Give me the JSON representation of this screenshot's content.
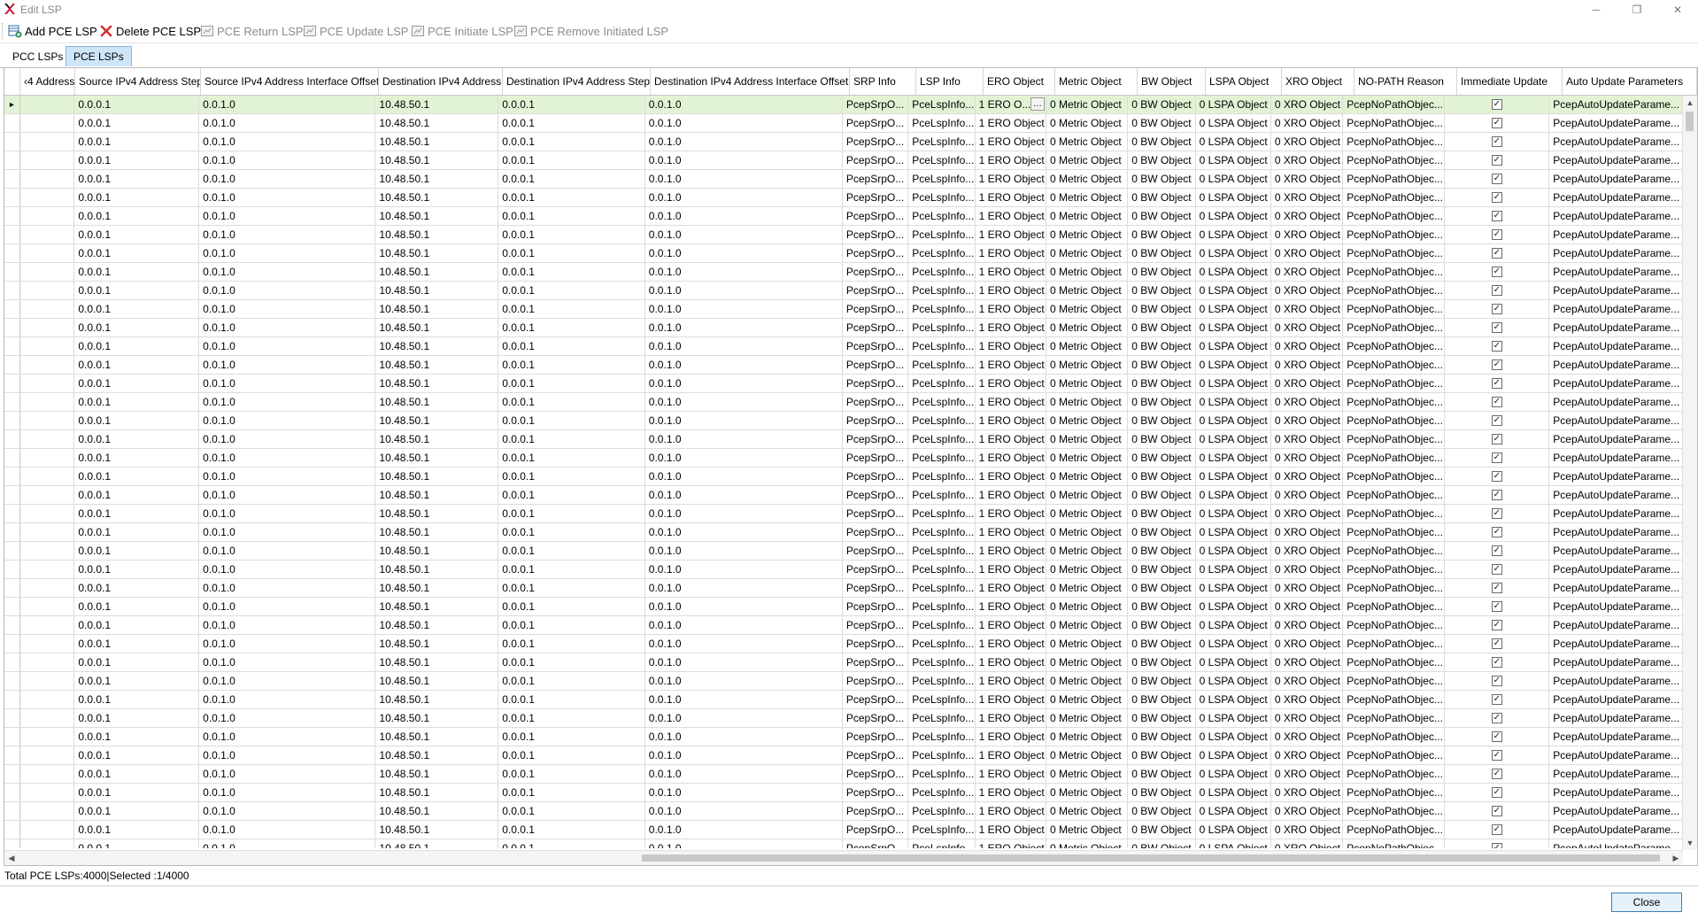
{
  "window": {
    "title": "Edit LSP",
    "controls": {
      "minimize": "─",
      "restore": "❐",
      "close": "✕"
    }
  },
  "toolbar": {
    "buttons": [
      {
        "label": "Add PCE LSP",
        "icon": "add-table-icon",
        "enabled": true
      },
      {
        "label": "Delete PCE LSP",
        "icon": "delete-x-icon",
        "enabled": true
      },
      {
        "label": "PCE Return LSP",
        "icon": "generic-action-icon",
        "enabled": false
      },
      {
        "label": "PCE Update LSP",
        "icon": "generic-action-icon",
        "enabled": false
      },
      {
        "label": "PCE Initiate LSP",
        "icon": "generic-action-icon",
        "enabled": false
      },
      {
        "label": "PCE Remove Initiated LSP",
        "icon": "generic-action-icon",
        "enabled": false
      }
    ]
  },
  "tabs": [
    {
      "label": "PCC LSPs",
      "active": false
    },
    {
      "label": "PCE LSPs",
      "active": true
    }
  ],
  "grid": {
    "columns": [
      "‹4 Address",
      "Source IPv4 Address Step",
      "Source IPv4 Address Interface Offset",
      "Destination IPv4 Address",
      "Destination IPv4 Address Step",
      "Destination IPv4 Address Interface Offset",
      "SRP Info",
      "LSP Info",
      "ERO Object",
      "Metric Object",
      "BW Object",
      "LSPA Object",
      "XRO Object",
      "NO-PATH Reason",
      "Immediate Update",
      "Auto Update Parameters"
    ],
    "row_template": {
      "src_addr": "",
      "src_step": "0.0.0.1",
      "src_iface_offset": "0.0.1.0",
      "dst_addr": "10.48.50.1",
      "dst_step": "0.0.0.1",
      "dst_iface_offset": "0.0.1.0",
      "srp_info": "PcepSrpO...",
      "lsp_info": "PceLspInfo...",
      "ero": "1 ERO Object",
      "metric": "0 Metric Object",
      "bw": "0 BW Object",
      "lspa": "0 LSPA Object",
      "xro": "0 XRO Object",
      "no_path": "PcepNoPathObjec...",
      "immediate_update": true,
      "auto_update": "PcepAutoUpdateParame..."
    },
    "selected_row_ero": "1 ERO O...",
    "visible_row_count": 41,
    "selected_row_index": 0
  },
  "status": {
    "text": "Total PCE LSPs:4000|Selected :1/4000"
  },
  "footer": {
    "close_label": "Close"
  }
}
